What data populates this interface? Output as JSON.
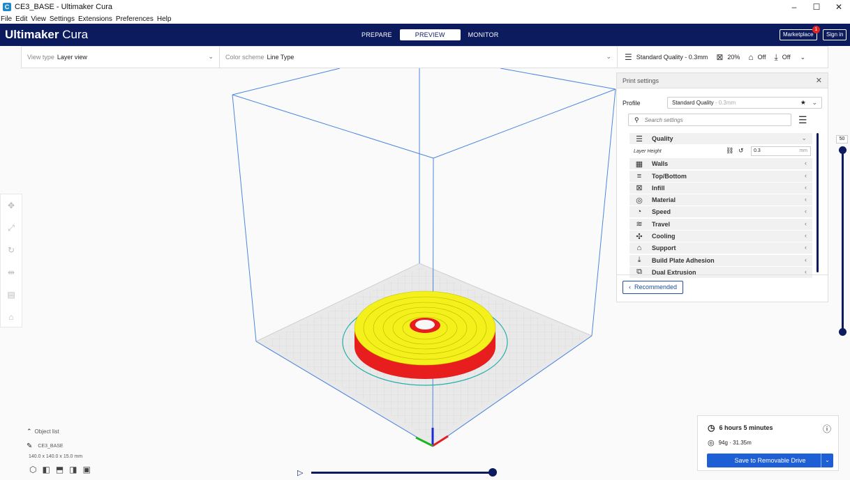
{
  "window": {
    "title": "CE3_BASE - Ultimaker Cura",
    "app_icon": "C"
  },
  "menu": [
    "File",
    "Edit",
    "View",
    "Settings",
    "Extensions",
    "Preferences",
    "Help"
  ],
  "header": {
    "brand_bold": "Ultimaker",
    "brand_light": " Cura",
    "tabs": [
      "PREPARE",
      "PREVIEW",
      "MONITOR"
    ],
    "active_tab": "PREVIEW",
    "marketplace": "Marketplace",
    "marketplace_badge": "1",
    "sign_in": "Sign in"
  },
  "viewbar": {
    "view_type_label": "View type",
    "view_type_value": "Layer view",
    "color_scheme_label": "Color scheme",
    "color_scheme_value": "Line Type",
    "quality": "Standard Quality - 0.3mm",
    "infill": "20%",
    "support": "Off",
    "adhesion": "Off"
  },
  "print_settings": {
    "title": "Print settings",
    "profile_label": "Profile",
    "profile_value": "Standard Quality",
    "profile_dim": "- 0.3mm",
    "search_placeholder": "Search settings",
    "layer_height_label": "Layer Height",
    "layer_height_value": "0.3",
    "layer_height_unit": "mm",
    "categories": [
      "Quality",
      "Walls",
      "Top/Bottom",
      "Infill",
      "Material",
      "Speed",
      "Travel",
      "Cooling",
      "Support",
      "Build Plate Adhesion",
      "Dual Extrusion"
    ],
    "recommended": "Recommended"
  },
  "layer_slider": {
    "label": "50"
  },
  "object_list": {
    "header": "Object list",
    "object_name": "CE3_BASE",
    "dimensions": "140.0 x 140.0 x 15.0 mm"
  },
  "job": {
    "time": "6 hours 5 minutes",
    "material": "94g · 31.35m",
    "save_button": "Save to Removable Drive"
  },
  "colors": {
    "header_bg": "#0c1a5e",
    "accent": "#1e5fd6",
    "model_top": "#f2f21a",
    "model_side": "#ee1d1d",
    "build_volume": "#3a7be0"
  }
}
